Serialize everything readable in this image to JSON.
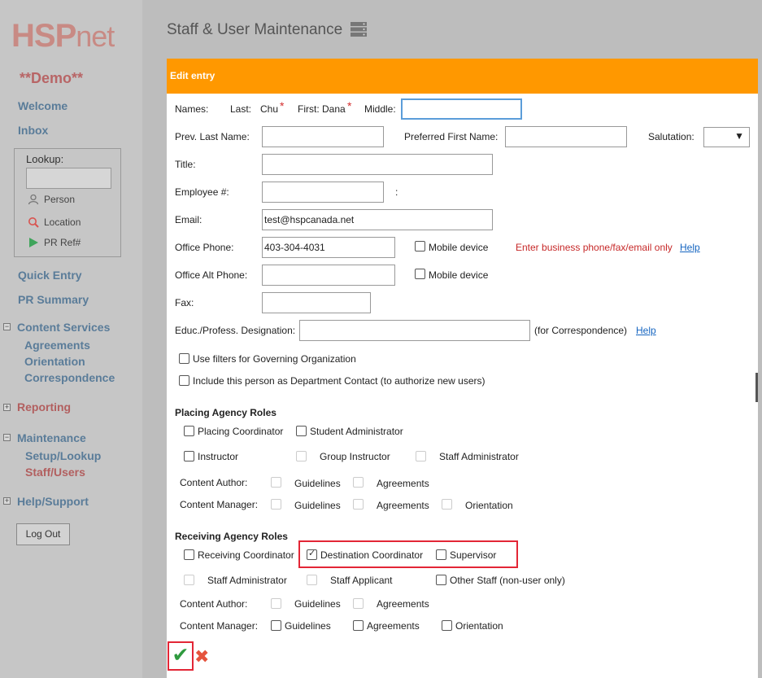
{
  "app": {
    "logo_primary": "HSP",
    "logo_secondary": "net",
    "environment": "**Demo**"
  },
  "sidebar": {
    "welcome": "Welcome",
    "inbox": "Inbox",
    "lookup": {
      "label": "Lookup:",
      "input_value": "",
      "person": "Person",
      "location": "Location",
      "pr_ref": "PR Ref#"
    },
    "quick_entry": "Quick Entry",
    "pr_summary": "PR Summary",
    "content_services": {
      "label": "Content Services",
      "expander": "⊟",
      "items": [
        "Agreements",
        "Orientation",
        "Correspondence"
      ]
    },
    "reporting": {
      "label": "Reporting",
      "expander": "⊞"
    },
    "maintenance": {
      "label": "Maintenance",
      "expander": "⊟",
      "items": [
        "Setup/Lookup",
        "Staff/Users"
      ]
    },
    "help_support": {
      "label": "Help/Support",
      "expander": "⊞"
    },
    "logout": "Log Out"
  },
  "header": {
    "title": "Staff & User Maintenance",
    "icon": "server-list-icon"
  },
  "dialog": {
    "title": "Edit entry",
    "names_label": "Names:",
    "last_label": "Last:",
    "last_value": "Chu",
    "first_label": "First:",
    "first_value": "Dana",
    "required_marker": "*",
    "middle_label": "Middle:",
    "middle_value": "",
    "prev_last_label": "Prev. Last Name:",
    "prev_last_value": "",
    "preferred_first_label": "Preferred First Name:",
    "preferred_first_value": "",
    "salutation_label": "Salutation:",
    "salutation_value": "",
    "title_label": "Title:",
    "title_value": "",
    "employee_label": "Employee #:",
    "employee_value": "",
    "employee_suffix": ":",
    "email_label": "Email:",
    "email_value": "test@hspcanada.net",
    "office_phone_label": "Office Phone:",
    "office_phone_value": "403-304-4031",
    "mobile_device_1": "Mobile device",
    "business_note": "Enter business phone/fax/email only",
    "help_1": "Help",
    "office_alt_label": "Office Alt Phone:",
    "office_alt_value": "",
    "mobile_device_2": "Mobile device",
    "fax_label": "Fax:",
    "fax_value": "",
    "designation_label": "Educ./Profess. Designation:",
    "designation_value": "",
    "for_correspondence": "(for Correspondence)",
    "help_2": "Help",
    "use_filters": "Use filters for Governing Organization",
    "include_contact": "Include this person as Department Contact (to authorize new users)",
    "placing": {
      "heading": "Placing Agency Roles",
      "placing_coordinator": "Placing Coordinator",
      "student_administrator": "Student Administrator",
      "instructor": "Instructor",
      "group_instructor": "Group Instructor",
      "staff_administrator": "Staff Administrator",
      "content_author": "Content Author:",
      "content_manager": "Content Manager:",
      "guidelines": "Guidelines",
      "agreements": "Agreements",
      "orientation": "Orientation"
    },
    "receiving": {
      "heading": "Receiving Agency Roles",
      "receiving_coordinator": "Receiving Coordinator",
      "destination_coordinator": "Destination Coordinator",
      "supervisor": "Supervisor",
      "staff_administrator": "Staff Administrator",
      "staff_applicant": "Staff Applicant",
      "other_staff": "Other Staff (non-user only)",
      "content_author": "Content Author:",
      "content_manager": "Content Manager:",
      "guidelines": "Guidelines",
      "agreements": "Agreements",
      "orientation": "Orientation"
    },
    "save_icon": "✔",
    "cancel_icon": "✖"
  },
  "colors": {
    "dialog_header": "#ff9800",
    "highlight": "#e32636",
    "link": "#1565c0",
    "nav_link": "#5a7c99",
    "nav_active": "#b25f5f"
  }
}
